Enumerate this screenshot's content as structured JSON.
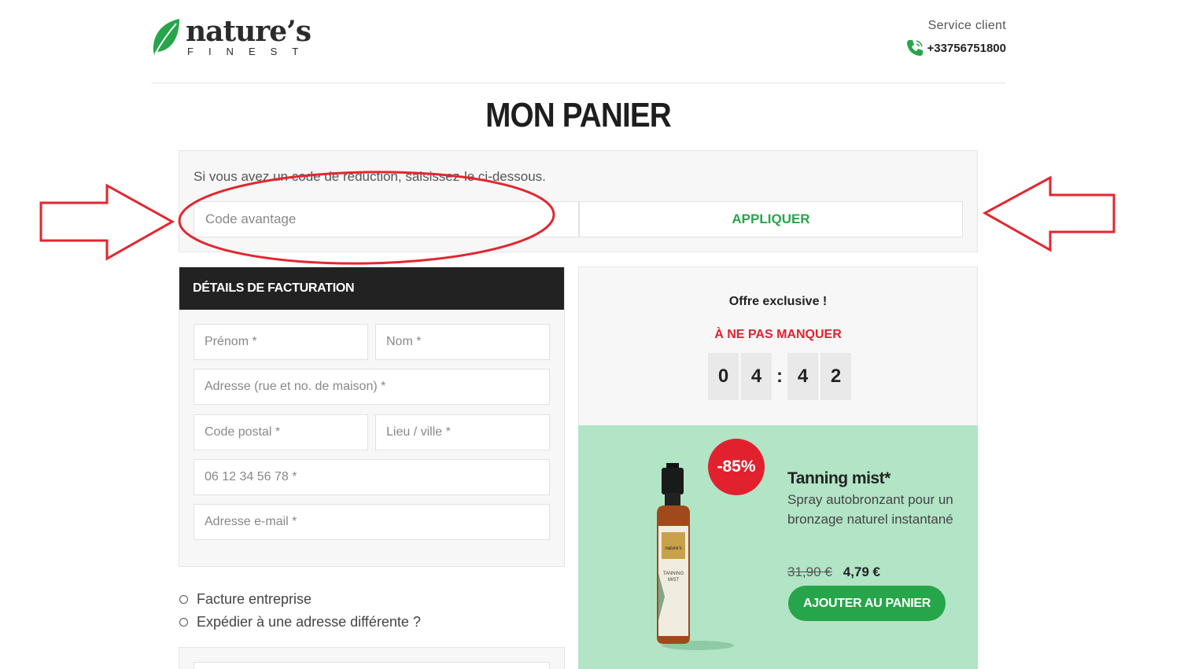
{
  "header": {
    "logo_main": "nature’s",
    "logo_sub": "FINEST",
    "service_label": "Service client",
    "phone": "+33756751800"
  },
  "page_title": "MON PANIER",
  "coupon": {
    "text": "Si vous avez un code de réduction, saisissez-le ci-dessous.",
    "placeholder": "Code avantage",
    "apply_label": "APPLIQUER"
  },
  "billing": {
    "heading": "DÉTAILS DE FACTURATION",
    "first_name_placeholder": "Prénom *",
    "last_name_placeholder": "Nom *",
    "address_placeholder": "Adresse (rue et no. de maison) *",
    "postal_placeholder": "Code postal *",
    "city_placeholder": "Lieu / ville *",
    "phone_placeholder": "06 12 34 56 78 *",
    "email_placeholder": "Adresse e-mail *"
  },
  "options": {
    "company_invoice": "Facture entreprise",
    "ship_different": "Expédier à une adresse différente ?"
  },
  "offer": {
    "title": "Offre exclusive !",
    "subtitle": "À NE PAS MANQUER",
    "timer": [
      "0",
      "4",
      "4",
      "2"
    ]
  },
  "product": {
    "badge": "-85%",
    "name": "Tanning mist*",
    "description": "Spray autobronzant pour un bronzage naturel instantané",
    "old_price": "31,90 €",
    "new_price": "4,79 €",
    "add_label": "AJOUTER AU PANIER"
  },
  "colors": {
    "accent_green": "#27a54a",
    "alert_red": "#e2212f",
    "product_bg": "#b2e4c6",
    "annotation_red": "#e3262e"
  }
}
